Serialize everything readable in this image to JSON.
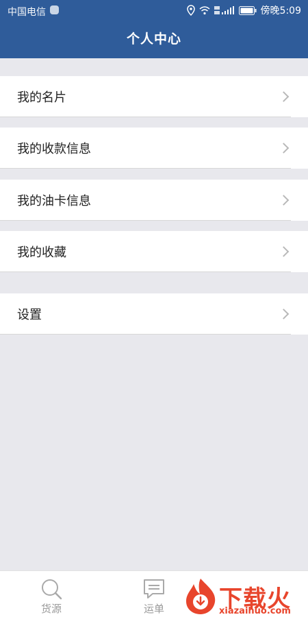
{
  "status_bar": {
    "carrier": "中国电信",
    "time": "傍晚5:09"
  },
  "header": {
    "title": "个人中心"
  },
  "menu": {
    "items": [
      {
        "label": "我的名片"
      },
      {
        "label": "我的收款信息"
      },
      {
        "label": "我的油卡信息"
      },
      {
        "label": "我的收藏"
      },
      {
        "label": "设置"
      }
    ]
  },
  "tabbar": {
    "tabs": [
      {
        "label": "货源",
        "icon": "search-icon"
      },
      {
        "label": "运单",
        "icon": "message-icon"
      }
    ]
  },
  "watermark": {
    "brand": "下载火",
    "url": "xiazaihuo.com"
  },
  "colors": {
    "header_bg": "#2f5c9a",
    "page_bg": "#e8e8ed",
    "watermark": "#e8452c"
  }
}
